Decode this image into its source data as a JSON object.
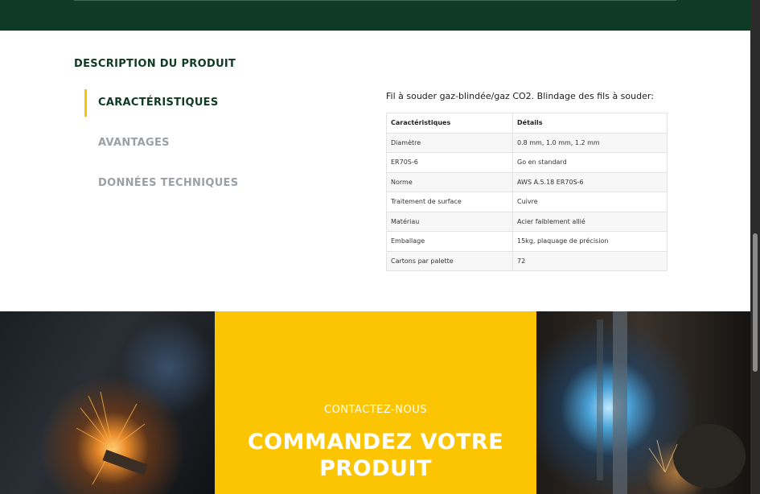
{
  "header": {
    "band_color": "#0f3a26"
  },
  "description": {
    "title": "DESCRIPTION DU PRODUIT",
    "tabs": [
      {
        "label": "CARACTÉRISTIQUES",
        "active": true
      },
      {
        "label": "AVANTAGES",
        "active": false
      },
      {
        "label": "DONNÉES TECHNIQUES",
        "active": false
      }
    ],
    "intro": "Fil à souder gaz-blindée/gaz CO2. Blindage des fils à souder:",
    "table": {
      "headers": [
        "Caractéristiques",
        "Détails"
      ],
      "rows": [
        [
          "Diamètre",
          "0.8 mm, 1.0 mm, 1.2 mm"
        ],
        [
          "ER70S-6",
          "Go en standard"
        ],
        [
          "Norme",
          "AWS A.5.18 ER70S-6"
        ],
        [
          "Traitement de surface",
          "Cuivre"
        ],
        [
          "Matériau",
          "Acier faiblement allié"
        ],
        [
          "Emballage",
          "15kg, plaquage de précision"
        ],
        [
          "Cartons par palette",
          "72"
        ]
      ]
    }
  },
  "cta": {
    "kicker": "CONTACTEZ-NOUS",
    "headline": "COMMANDEZ VOTRE PRODUIT",
    "background": "#fcc504"
  },
  "colors": {
    "accent": "#f5c400",
    "brand_green": "#0f3a26"
  }
}
